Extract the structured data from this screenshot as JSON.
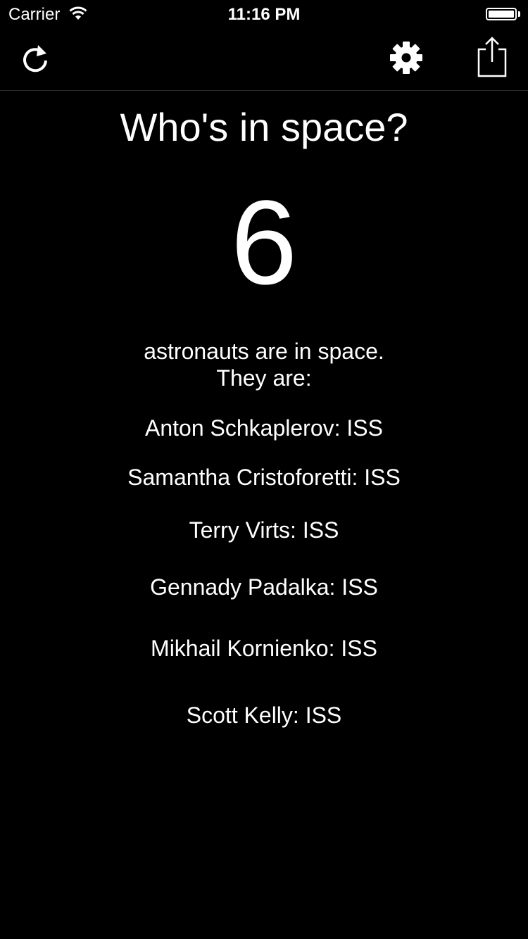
{
  "status_bar": {
    "carrier": "Carrier",
    "time": "11:16 PM",
    "wifi_icon": "wifi-icon",
    "battery_icon": "battery-full-icon"
  },
  "nav_bar": {
    "refresh_icon": "refresh-icon",
    "settings_icon": "gear-icon",
    "share_icon": "share-icon"
  },
  "main": {
    "title": "Who's in space?",
    "count": "6",
    "intro_line1": "astronauts are in space.",
    "intro_line2": "They are:",
    "people": [
      "Anton Schkaplerov: ISS",
      "Samantha Cristoforetti: ISS",
      "Terry Virts: ISS",
      "Gennady Padalka: ISS",
      "Mikhail Kornienko: ISS",
      "Scott Kelly: ISS"
    ]
  },
  "colors": {
    "background": "#000000",
    "text": "#ffffff"
  }
}
